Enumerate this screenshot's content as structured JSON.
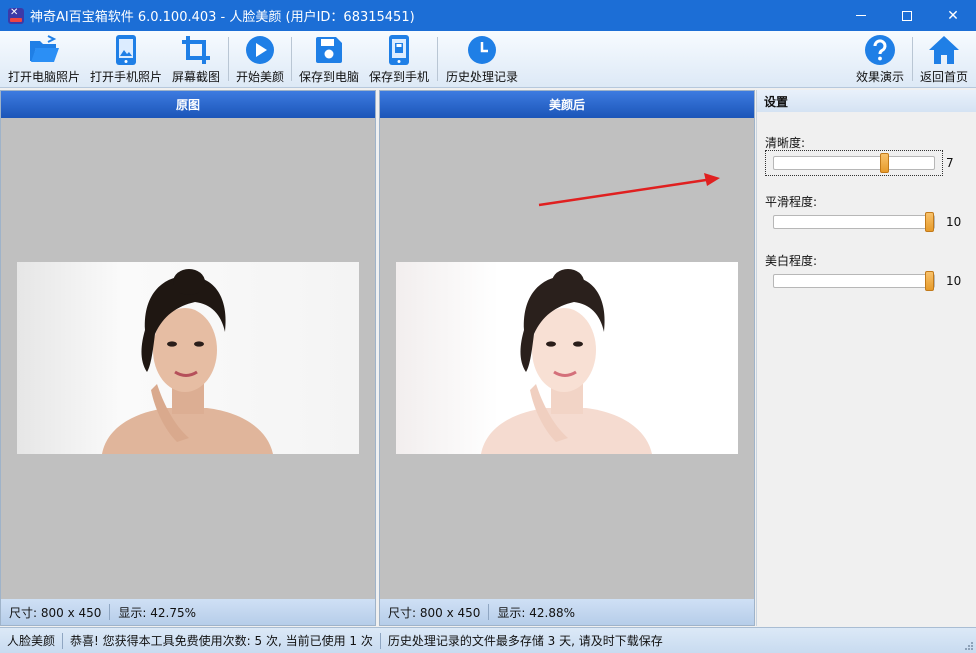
{
  "window": {
    "title": "神奇AI百宝箱软件 6.0.100.403 - 人脸美颜 (用户ID：68315451)",
    "accent_color": "#1c6ed6",
    "controls": [
      "minimize-icon",
      "maximize-icon",
      "close-icon"
    ]
  },
  "toolbar": {
    "buttons": [
      {
        "label": "打开电脑照片",
        "icon": "folder-open-icon"
      },
      {
        "label": "打开手机照片",
        "icon": "phone-image-icon"
      },
      {
        "label": "屏幕截图",
        "icon": "crop-icon"
      },
      {
        "label": "开始美颜",
        "icon": "play-icon"
      },
      {
        "label": "保存到电脑",
        "icon": "save-disk-icon"
      },
      {
        "label": "保存到手机",
        "icon": "save-phone-icon"
      },
      {
        "label": "历史处理记录",
        "icon": "clock-icon"
      },
      {
        "label": "效果演示",
        "icon": "help-icon"
      },
      {
        "label": "返回首页",
        "icon": "home-icon"
      }
    ]
  },
  "panels": {
    "original": {
      "header": "原图",
      "size": "尺寸: 800 x 450",
      "display": "显示: 42.75%"
    },
    "beautified": {
      "header": "美颜后",
      "size": "尺寸: 800 x 450",
      "display": "显示: 42.88%"
    }
  },
  "settings": {
    "title": "设置",
    "items": [
      {
        "label": "清晰度:",
        "value": "7",
        "fraction": 0.7
      },
      {
        "label": "平滑程度:",
        "value": "10",
        "fraction": 1.0
      },
      {
        "label": "美白程度:",
        "value": "10",
        "fraction": 1.0
      }
    ]
  },
  "statusbar": {
    "module": "人脸美颜",
    "usage": "恭喜! 您获得本工具免费使用次数: 5 次, 当前已使用 1 次",
    "history": "历史处理记录的文件最多存储 3 天, 请及时下载保存"
  }
}
